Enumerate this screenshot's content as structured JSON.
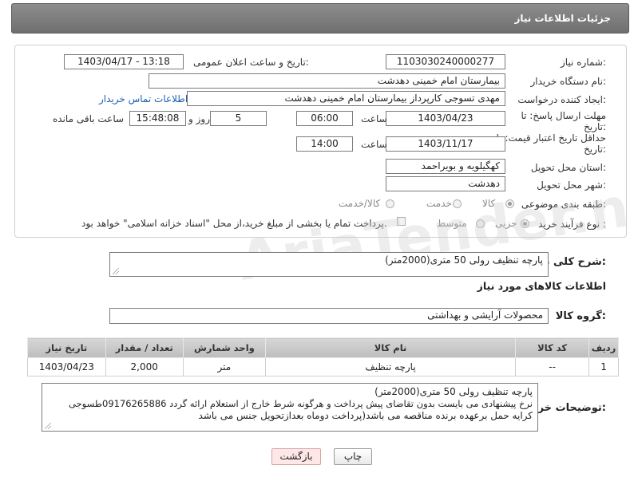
{
  "header": {
    "title": "جزئیات اطلاعات نیاز"
  },
  "form": {
    "need_number": {
      "label": "شماره نیاز:",
      "value": "1103030240000277"
    },
    "announce_datetime": {
      "label": "تاریخ و ساعت اعلان عمومی:",
      "value": "1403/04/17 - 13:18"
    },
    "buyer_org": {
      "label": "نام دستگاه خریدار:",
      "value": "بیمارستان امام خمینی دهدشت"
    },
    "requester": {
      "label": "ایجاد کننده درخواست:",
      "value": "مهدی تسوجی کارپرداز بیمارستان امام خمینی دهدشت",
      "contact_link": "اطلاعات تماس خریدار"
    },
    "reply_deadline": {
      "label_line1": "مهلت ارسال پاسخ: تا",
      "label_line2": "تاریخ:",
      "date": "1403/04/23",
      "time_label": "ساعت",
      "time": "06:00",
      "days": "5",
      "days_label": "روز و",
      "remaining": "15:48:08",
      "remaining_label": "ساعت باقی مانده"
    },
    "price_validity": {
      "label_line1": "حداقل تاریخ اعتبار قیمت: تا",
      "label_line2": "تاریخ:",
      "date": "1403/11/17",
      "time_label": "ساعت",
      "time": "14:00"
    },
    "province": {
      "label": "استان محل تحویل:",
      "value": "کهگیلویه و بویراحمد"
    },
    "city": {
      "label": "شهر محل تحویل:",
      "value": "دهدشت"
    },
    "category": {
      "label": "طبقه بندی موضوعی:",
      "options": [
        "کالا",
        "خدمت",
        "کالا/خدمت"
      ],
      "selected": "کالا"
    },
    "purchase_type": {
      "label": "نوع فرآیند خرید :",
      "options": [
        "جزیی",
        "متوسط"
      ],
      "selected": "جزیی",
      "payment_note": "پرداخت تمام یا بخشی از مبلغ خرید،از محل \"اسناد خزانه اسلامی\" خواهد بود."
    }
  },
  "summary": {
    "label": "شرح کلی نیاز:",
    "value": "پارچه تنظیف رولی 50 متری(2000متر)"
  },
  "goods_section": {
    "title": "اطلاعات کالاهای مورد نیاز",
    "group_label": "گروه کالا:",
    "group_value": "محصولات آرایشی و بهداشتی"
  },
  "table": {
    "headers": [
      "ردیف",
      "کد کالا",
      "نام کالا",
      "واحد شمارش",
      "تعداد / مقدار",
      "تاریخ نیاز"
    ],
    "rows": [
      [
        "1",
        "--",
        "پارچه تنظیف",
        "متر",
        "2,000",
        "1403/04/23"
      ]
    ]
  },
  "buyer_notes": {
    "label": "توضیحات خریدار:",
    "line1": "پارچه تنظیف رولی 50 متری(2000متر)",
    "line2": "نرخ پیشنهادی می بایست بدون تقاضای پیش پرداخت و هرگونه شرط خارج از استعلام ارائه گردد 09176265886طسوجی",
    "line3": "کرایه حمل برعهده برنده مناقصه می باشد(پرداخت دوماه بعدازتحویل جنس می باشد"
  },
  "buttons": {
    "print": "چاپ",
    "back": "بازگشت"
  },
  "watermark": {
    "text": "AriaTender.neT"
  }
}
